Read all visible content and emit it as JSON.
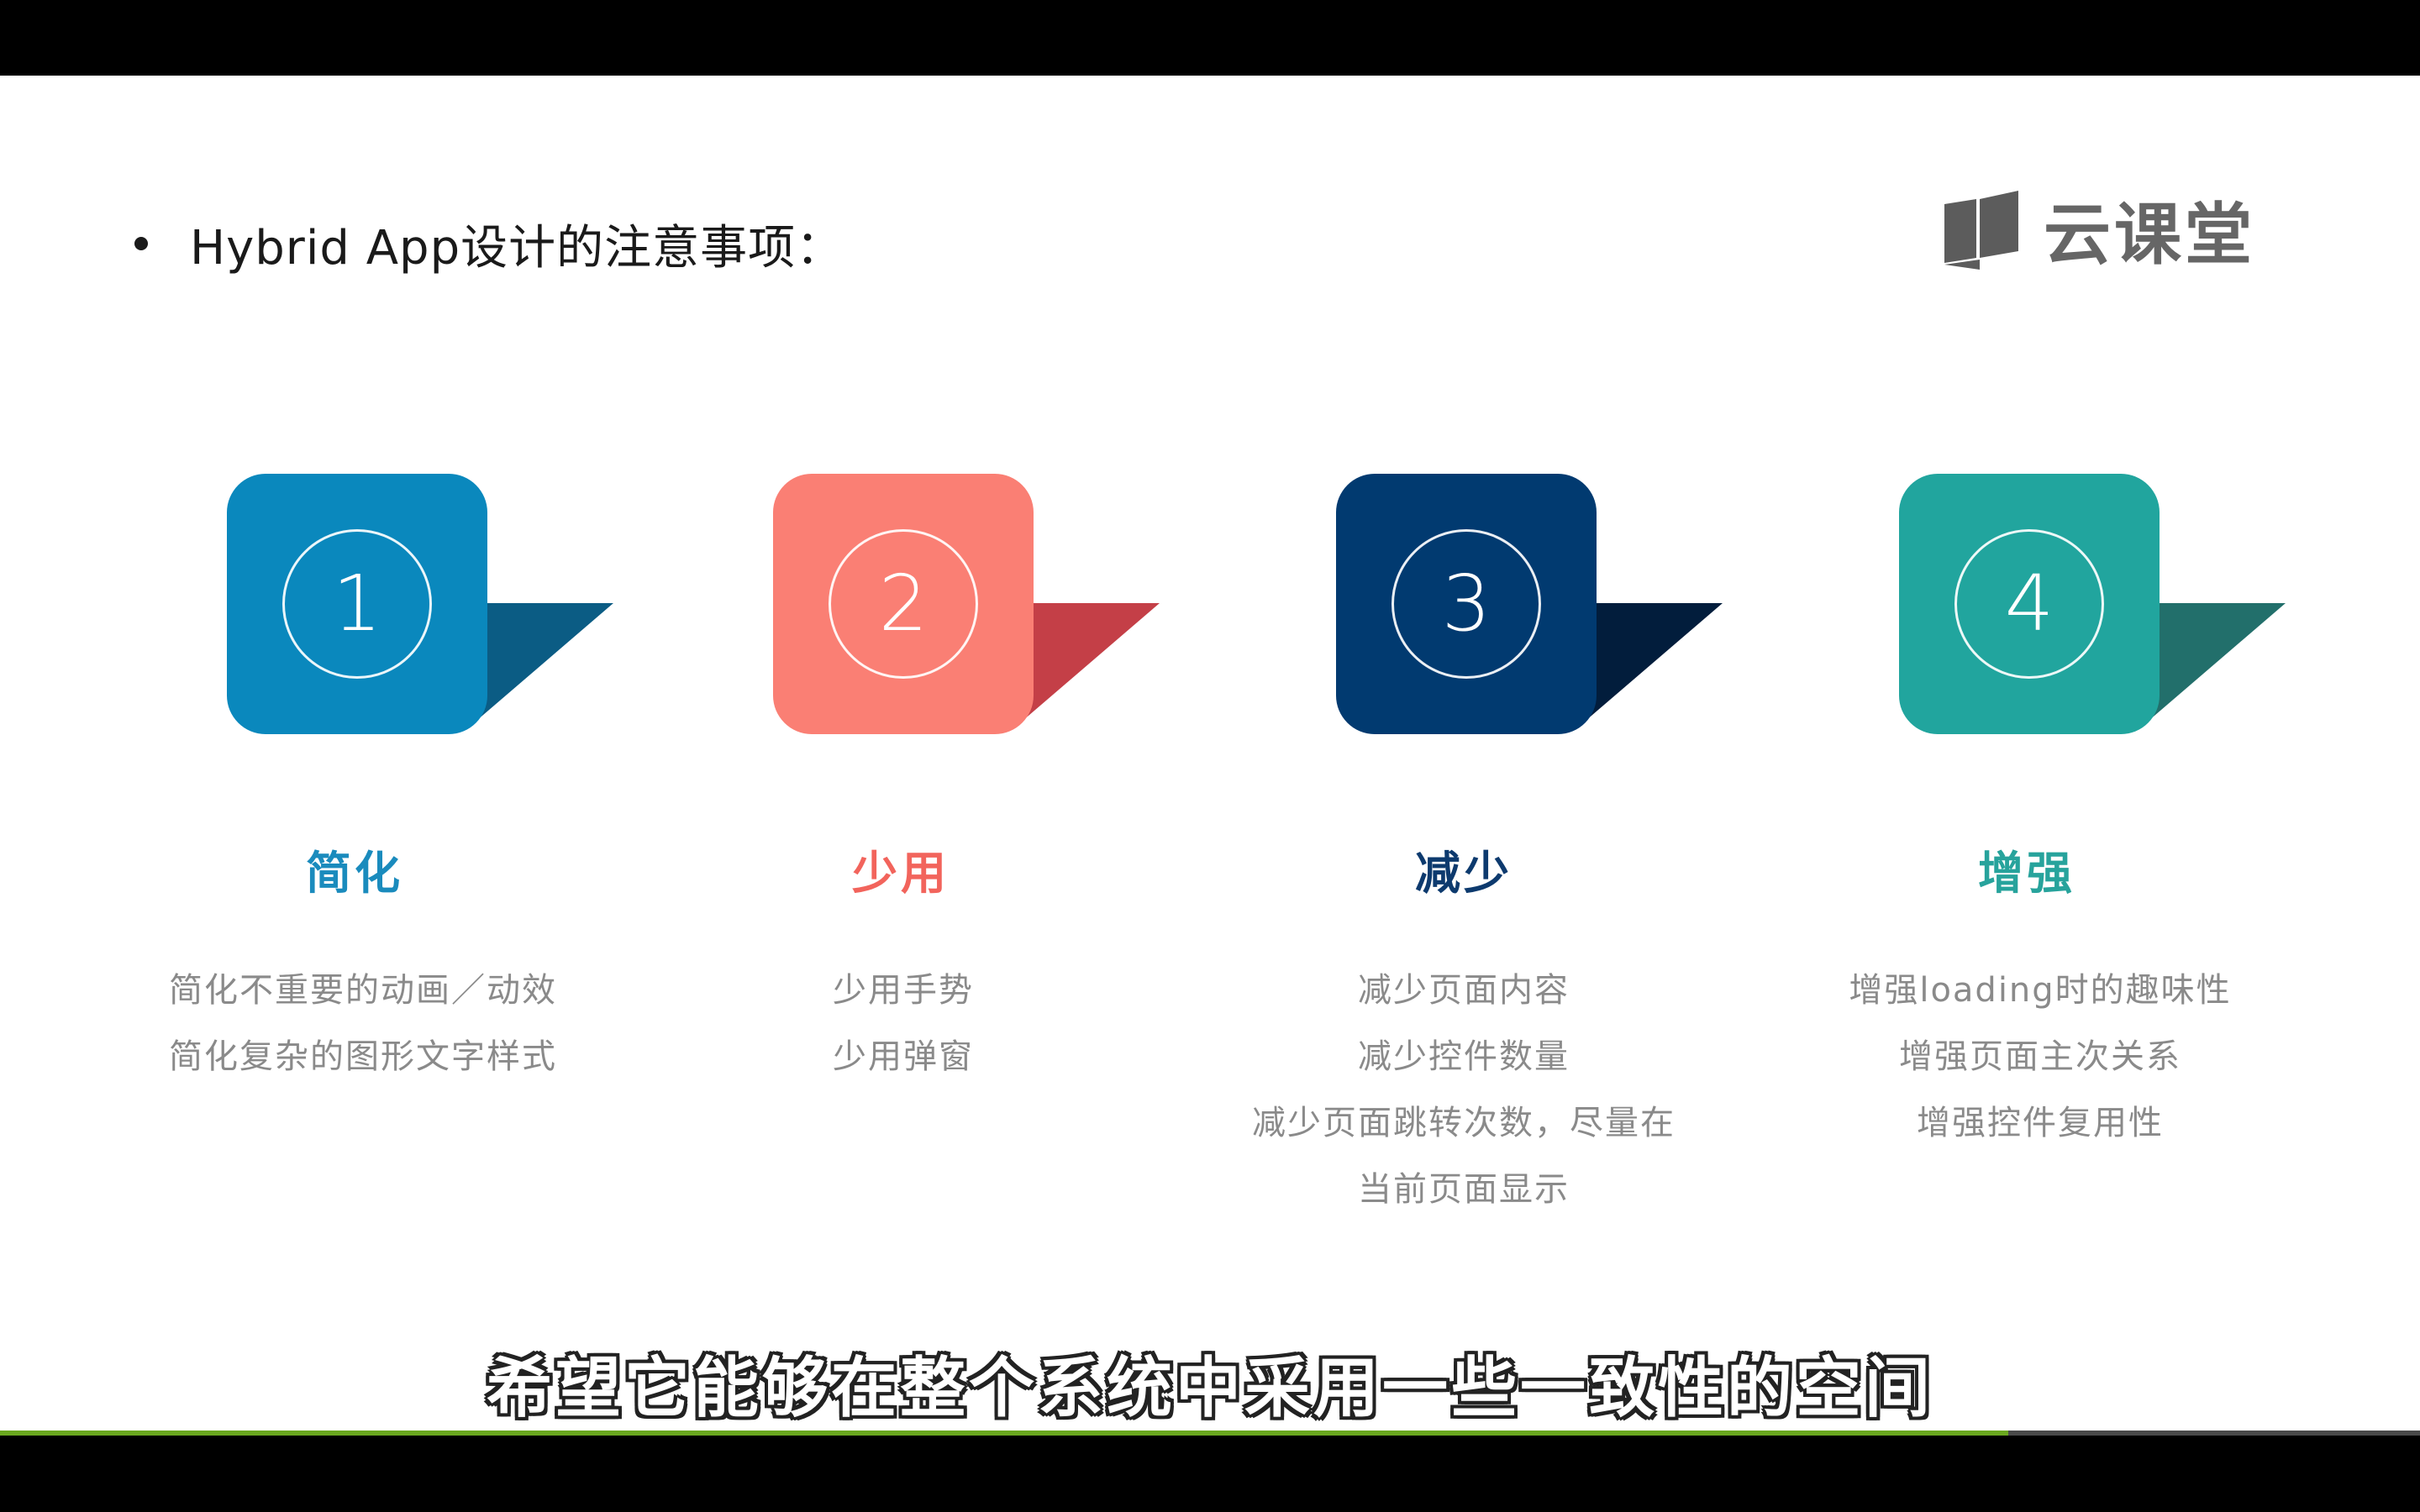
{
  "slide": {
    "title": "Hybrid App设计的注意事项：",
    "logo_text": "云课堂",
    "subtitle": "希望它能够在整个系统中采用一些一致性的空间"
  },
  "cards": [
    {
      "number": "1",
      "heading": "简化",
      "color": "#0a88bd",
      "tail_color": "#0b5c84",
      "lines": [
        "简化不重要的动画／动效",
        "简化复杂的图形文字样式"
      ]
    },
    {
      "number": "2",
      "heading": "少用",
      "color": "#fa7f74",
      "tail_color": "#c43f47",
      "lines": [
        "少用手势",
        "少用弹窗"
      ]
    },
    {
      "number": "3",
      "heading": "减少",
      "color": "#013a70",
      "tail_color": "#021d3c",
      "lines": [
        "减少页面内容",
        "减少控件数量",
        "减少页面跳转次数，尽量在",
        "当前页面显示"
      ]
    },
    {
      "number": "4",
      "heading": "增强",
      "color": "#21a59e",
      "tail_color": "#226f6b",
      "lines": [
        "增强loading时的趣味性",
        "增强页面主次关系",
        "增强控件复用性"
      ]
    }
  ],
  "heading_colors": [
    "#1a8bbd",
    "#f2645c",
    "#0d3a6e",
    "#27a39c"
  ],
  "progress": {
    "fraction": 0.83,
    "color": "#6aa81f"
  }
}
